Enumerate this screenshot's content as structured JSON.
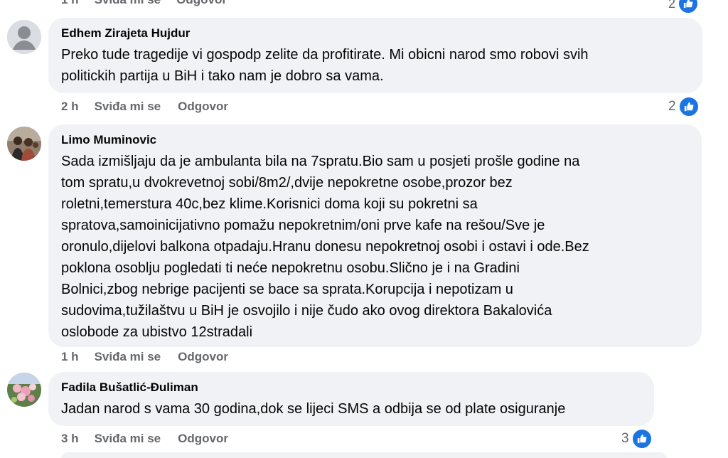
{
  "top_partial": {
    "time": "1 h",
    "like": "Sviđa mi se",
    "reply": "Odgovor",
    "reaction_count": "2"
  },
  "comments": [
    {
      "author": "Edhem Zirajeta Hujdur",
      "text": "Preko tude tragedije vi gospodp zelite da profitirate. Mi obicni narod smo robovi svih\npolitickih partija u BiH i tako nam je dobro sa vama.",
      "time": "2 h",
      "like": "Sviđa mi se",
      "reply": "Odgovor",
      "reaction_count": "2",
      "avatar_icon": "default-profile-icon"
    },
    {
      "author": "Limo Muminovic",
      "text": "Sada izmišljaju da je ambulanta bila na 7spratu.Bio sam u posjeti prošle godine na\ntom spratu,u dvokrevetnoj sobi/8m2/,dvije nepokretne osobe,prozor bez\nroletni,temerstura 40c,bez klime.Korisnici doma koji su pokretni sa\nspratova,samoinicijativno pomažu nepokretnim/oni prve kafe na rešou/Sve je\noronulo,dijelovi balkona otpadaju.Hranu donesu nepokretnoj osobi i ostavi i ode.Bez\npoklona osoblju pogledati ti neće nepokretnu osobu.Slično je i na Gradini\nBolnici,zbog nebrige pacijenti se bace sa sprata.Korupcija i nepotizam u\nsudovima,tužilaštvu u BiH je osvojilo i nije čudo ako ovog direktora Bakalovića\noslobode za ubistvo 12stradali",
      "time": "1 h",
      "like": "Sviđa mi se",
      "reply": "Odgovor",
      "avatar_icon": "group-photo-avatar"
    },
    {
      "author": "Fadila Bušatlić-Đuliman",
      "text": "Jadan narod s vama 30 godina,dok se lijeci SMS a odbija se od plate osiguranje",
      "time": "3 h",
      "like": "Sviđa mi se",
      "reply": "Odgovor",
      "reaction_count": "3",
      "avatar_icon": "flowers-photo-avatar"
    }
  ],
  "colors": {
    "bubble": "#f0f2f5",
    "secondary_text": "#65676b",
    "like_blue": "#1b74e4",
    "primary_text": "#050505"
  }
}
